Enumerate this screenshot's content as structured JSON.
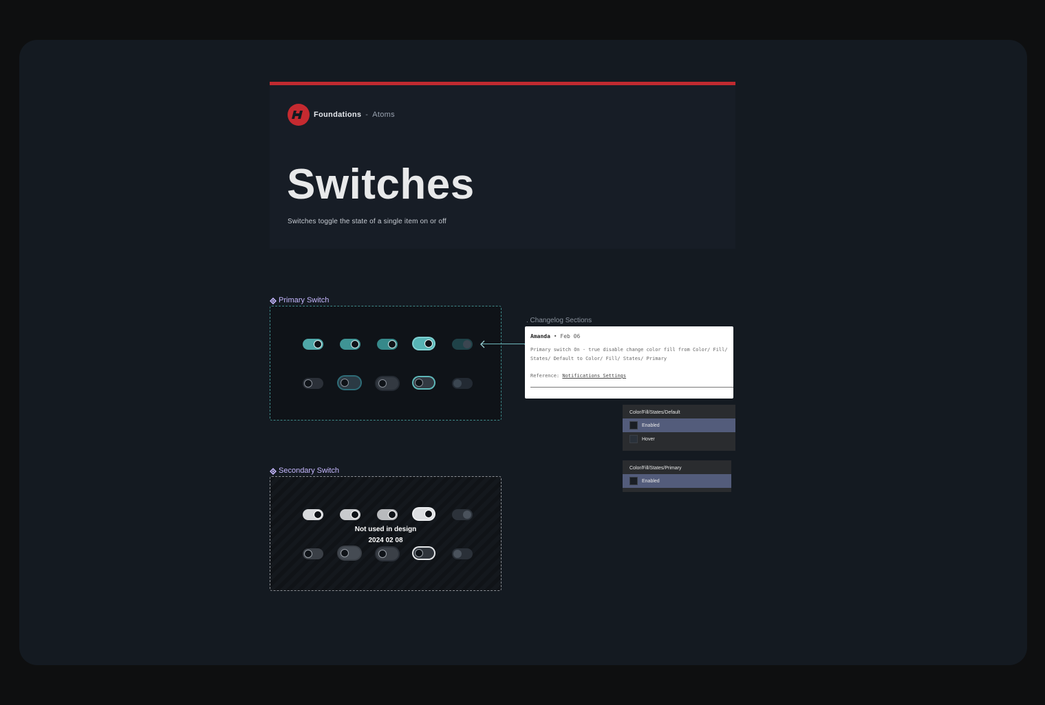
{
  "header": {
    "breadcrumb_main": "Foundations",
    "breadcrumb_sep": "-",
    "breadcrumb_sub": "Atoms",
    "title": "Switches",
    "subtitle": "Switches toggle the state of a single item on or off",
    "accent": "#c02a30"
  },
  "primary": {
    "label": "Primary Switch"
  },
  "secondary": {
    "label": "Secondary Switch",
    "overlay_line1": "Not used in design",
    "overlay_line2": "2024 02 08"
  },
  "changelog": {
    "section_label": ". Changelog Sections",
    "author": "Amanda",
    "bullet": "•",
    "date": "Feb 06",
    "body": "Primary switch On - true disable change color fill from Color/ Fill/ States/ Default to Color/ Fill/ States/ Primary",
    "reference_label": "Reference:",
    "reference_link": "Notifications Settings"
  },
  "tokens_default": {
    "title": "Color/Fill/States/Default",
    "rows": [
      "Enabled",
      "Hover"
    ]
  },
  "tokens_primary": {
    "title": "Color/Fill/States/Primary",
    "rows": [
      "Enabled"
    ]
  },
  "icons": {
    "logo": "brand-logo-icon",
    "component": "component-diamond-icon",
    "arrow": "arrow-left-icon"
  }
}
